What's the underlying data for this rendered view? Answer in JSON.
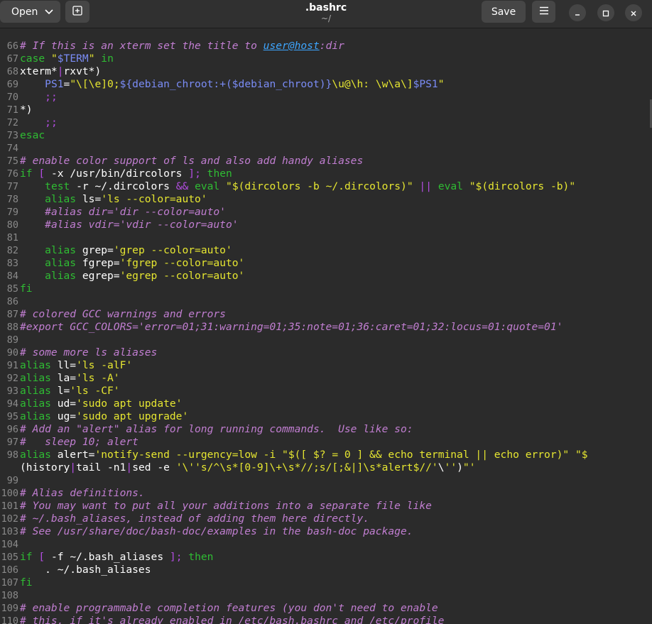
{
  "header": {
    "open_label": "Open",
    "title": ".bashrc",
    "subtitle": "~/",
    "save_label": "Save"
  },
  "icons": {
    "open_dropdown": "chevron-down-icon",
    "new_tab": "new-tab-icon",
    "menu": "hamburger-menu-icon",
    "minimize": "minimize-icon",
    "maximize": "maximize-icon",
    "close": "close-icon"
  },
  "colors": {
    "background": "#2b2b2b",
    "header": "#303030",
    "keyword": "#2fbc33",
    "string": "#e6e631",
    "comment": "#c17ed1",
    "variable": "#7a8cf5",
    "link": "#3ea6ff",
    "operator": "#b24de0",
    "line_number": "#8a8a8a",
    "text": "#ffffff"
  },
  "editor": {
    "lines": [
      {
        "n": "",
        "text": ""
      },
      {
        "n": "66",
        "text": "# If this is an xterm set the title to user@host:dir"
      },
      {
        "n": "67",
        "text": "case \"$TERM\" in"
      },
      {
        "n": "68",
        "text": "xterm*|rxvt*)"
      },
      {
        "n": "69",
        "text": "    PS1=\"\\[\\e]0;${debian_chroot:+($debian_chroot)}\\u@\\h: \\w\\a\\]$PS1\""
      },
      {
        "n": "70",
        "text": "    ;;"
      },
      {
        "n": "71",
        "text": "*)"
      },
      {
        "n": "72",
        "text": "    ;;"
      },
      {
        "n": "73",
        "text": "esac"
      },
      {
        "n": "74",
        "text": ""
      },
      {
        "n": "75",
        "text": "# enable color support of ls and also add handy aliases"
      },
      {
        "n": "76",
        "text": "if [ -x /usr/bin/dircolors ]; then"
      },
      {
        "n": "77",
        "text": "    test -r ~/.dircolors && eval \"$(dircolors -b ~/.dircolors)\" || eval \"$(dircolors -b)\""
      },
      {
        "n": "78",
        "text": "    alias ls='ls --color=auto'"
      },
      {
        "n": "79",
        "text": "    #alias dir='dir --color=auto'"
      },
      {
        "n": "80",
        "text": "    #alias vdir='vdir --color=auto'"
      },
      {
        "n": "81",
        "text": ""
      },
      {
        "n": "82",
        "text": "    alias grep='grep --color=auto'"
      },
      {
        "n": "83",
        "text": "    alias fgrep='fgrep --color=auto'"
      },
      {
        "n": "84",
        "text": "    alias egrep='egrep --color=auto'"
      },
      {
        "n": "85",
        "text": "fi"
      },
      {
        "n": "86",
        "text": ""
      },
      {
        "n": "87",
        "text": "# colored GCC warnings and errors"
      },
      {
        "n": "88",
        "text": "#export GCC_COLORS='error=01;31:warning=01;35:note=01;36:caret=01;32:locus=01:quote=01'"
      },
      {
        "n": "89",
        "text": ""
      },
      {
        "n": "90",
        "text": "# some more ls aliases"
      },
      {
        "n": "91",
        "text": "alias ll='ls -alF'"
      },
      {
        "n": "92",
        "text": "alias la='ls -A'"
      },
      {
        "n": "93",
        "text": "alias l='ls -CF'"
      },
      {
        "n": "94",
        "text": "alias ud='sudo apt update'"
      },
      {
        "n": "95",
        "text": "alias ug='sudo apt upgrade'"
      },
      {
        "n": "96",
        "text": "# Add an \"alert\" alias for long running commands.  Use like so:"
      },
      {
        "n": "97",
        "text": "#   sleep 10; alert"
      },
      {
        "n": "98",
        "text": "alias alert='notify-send --urgency=low -i \"$([ $? = 0 ] && echo terminal || echo error)\" \"$"
      },
      {
        "n": "",
        "text": "(history|tail -n1|sed -e '\\''s/^\\s*[0-9]\\+\\s*//;s/[;&|]\\s*alert$//'\\'')\"'"
      },
      {
        "n": "99",
        "text": ""
      },
      {
        "n": "100",
        "text": "# Alias definitions."
      },
      {
        "n": "101",
        "text": "# You may want to put all your additions into a separate file like"
      },
      {
        "n": "102",
        "text": "# ~/.bash_aliases, instead of adding them here directly."
      },
      {
        "n": "103",
        "text": "# See /usr/share/doc/bash-doc/examples in the bash-doc package."
      },
      {
        "n": "104",
        "text": ""
      },
      {
        "n": "105",
        "text": "if [ -f ~/.bash_aliases ]; then"
      },
      {
        "n": "106",
        "text": "    . ~/.bash_aliases"
      },
      {
        "n": "107",
        "text": "fi"
      },
      {
        "n": "108",
        "text": ""
      },
      {
        "n": "109",
        "text": "# enable programmable completion features (you don't need to enable"
      },
      {
        "n": "110",
        "text": "# this, if it's already enabled in /etc/bash.bashrc and /etc/profile"
      }
    ]
  }
}
